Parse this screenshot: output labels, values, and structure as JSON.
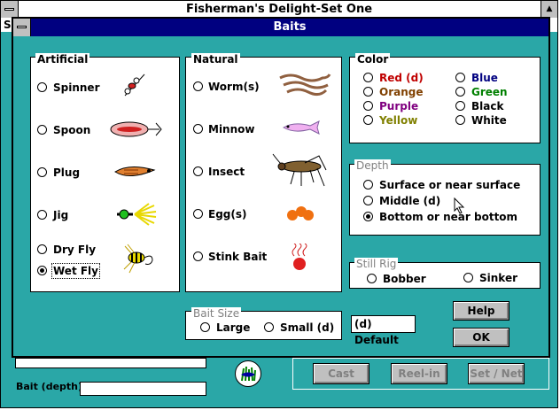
{
  "main_window": {
    "title": "Fisherman's Delight-Set One",
    "menu_peek": "S",
    "bait_depth_label": "Bait (depth):",
    "buttons": {
      "cast": "Cast",
      "reel_in": "Reel-in",
      "set_net": "Set / Net"
    }
  },
  "dialog": {
    "title": "Baits",
    "artificial": {
      "title": "Artificial",
      "options": [
        "Spinner",
        "Spoon",
        "Plug",
        "Jig",
        "Dry Fly",
        "Wet Fly"
      ],
      "selected": "Wet Fly"
    },
    "natural": {
      "title": "Natural",
      "options": [
        "Worm(s)",
        "Minnow",
        "Insect",
        "Egg(s)",
        "Stink Bait"
      ]
    },
    "color": {
      "title": "Color",
      "left": [
        {
          "label": "Red (d)",
          "color": "#c00000"
        },
        {
          "label": "Orange",
          "color": "#804000"
        },
        {
          "label": "Purple",
          "color": "#800080"
        },
        {
          "label": "Yellow",
          "color": "#808000"
        }
      ],
      "right": [
        {
          "label": "Blue",
          "color": "#000080"
        },
        {
          "label": "Green",
          "color": "#008000"
        },
        {
          "label": "Black",
          "color": "#000000"
        },
        {
          "label": "White",
          "color": "#000000"
        }
      ]
    },
    "depth": {
      "title": "Depth",
      "options": [
        "Surface or near surface",
        "Middle (d)",
        "Bottom or near bottom"
      ],
      "selected": "Bottom or near bottom"
    },
    "still_rig": {
      "title": "Still Rig",
      "options": [
        "Bobber",
        "Sinker"
      ]
    },
    "bait_size": {
      "title": "Bait Size",
      "options": [
        "Large",
        "Small (d)"
      ]
    },
    "default_note": "(d) Default",
    "help_button": "Help",
    "ok_button": "OK"
  }
}
